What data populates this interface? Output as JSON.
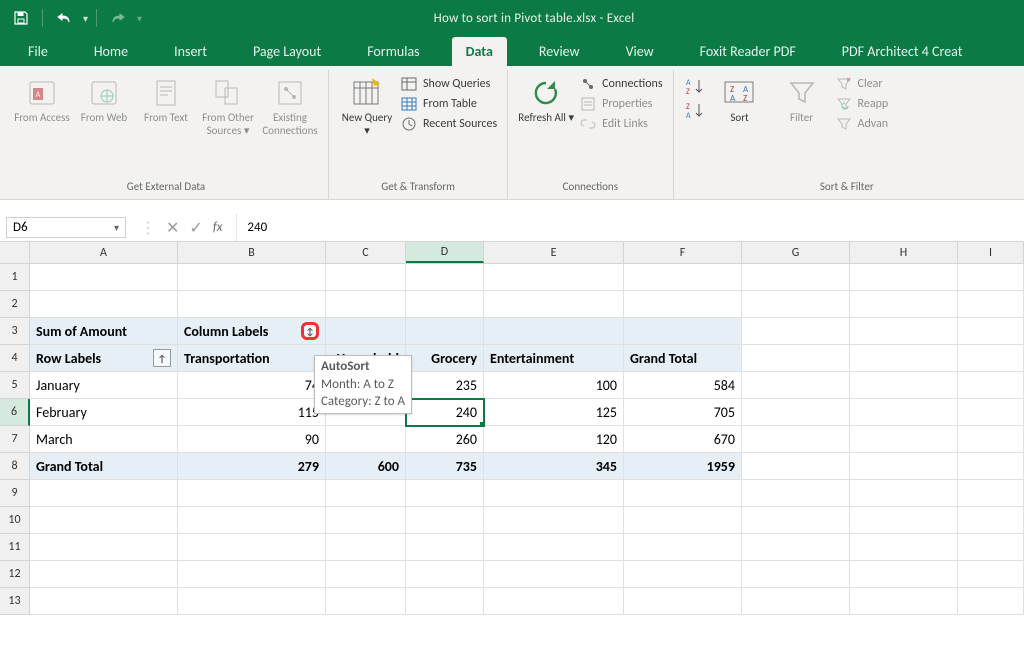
{
  "title": "How to sort in Pivot table.xlsx - Excel",
  "tabs": [
    "File",
    "Home",
    "Insert",
    "Page Layout",
    "Formulas",
    "Data",
    "Review",
    "View",
    "Foxit Reader PDF",
    "PDF Architect 4 Creat"
  ],
  "active_tab": "Data",
  "ribbon": {
    "get_external": {
      "access": "From Access",
      "web": "From Web",
      "text": "From Text",
      "other": "From Other Sources ▾",
      "existing": "Existing Connections",
      "label": "Get External Data"
    },
    "get_transform": {
      "new_query": "New Query ▾",
      "show": "Show Queries",
      "from_table": "From Table",
      "recent": "Recent Sources",
      "label": "Get & Transform"
    },
    "connections": {
      "refresh": "Refresh All ▾",
      "conn": "Connections",
      "props": "Properties",
      "links": "Edit Links",
      "label": "Connections"
    },
    "sort_filter": {
      "sort": "Sort",
      "filter": "Filter",
      "clear": "Clear",
      "reapply": "Reapp",
      "advanced": "Advan",
      "label": "Sort & Filter"
    }
  },
  "name_box": "D6",
  "formula_value": "240",
  "columns": [
    "A",
    "B",
    "C",
    "D",
    "E",
    "F",
    "G",
    "H",
    "I"
  ],
  "rows": [
    "1",
    "2",
    "3",
    "4",
    "5",
    "6",
    "7",
    "8",
    "9",
    "10",
    "11",
    "12",
    "13"
  ],
  "pivot": {
    "sum_label": "Sum of Amount",
    "col_labels": "Column Labels",
    "row_labels": "Row Labels",
    "cols": [
      "Transportation",
      "Household",
      "Grocery",
      "Entertainment",
      "Grand Total"
    ],
    "rows": [
      {
        "name": "January",
        "vals": [
          "74",
          "",
          "235",
          "100",
          "584"
        ]
      },
      {
        "name": "February",
        "vals": [
          "115",
          "",
          "240",
          "125",
          "705"
        ]
      },
      {
        "name": "March",
        "vals": [
          "90",
          "",
          "260",
          "120",
          "670"
        ]
      }
    ],
    "grand": {
      "name": "Grand Total",
      "vals": [
        "279",
        "600",
        "735",
        "345",
        "1959"
      ]
    }
  },
  "tooltip": {
    "title": "AutoSort",
    "l1": "Month: A to Z",
    "l2": "Category: Z to A"
  },
  "chart_data": {
    "type": "table",
    "title": "Sum of Amount",
    "columns": [
      "Transportation",
      "Household",
      "Grocery",
      "Entertainment",
      "Grand Total"
    ],
    "rows": [
      "January",
      "February",
      "March",
      "Grand Total"
    ],
    "values": [
      [
        74,
        null,
        235,
        100,
        584
      ],
      [
        115,
        null,
        240,
        125,
        705
      ],
      [
        90,
        null,
        260,
        120,
        670
      ],
      [
        279,
        600,
        735,
        345,
        1959
      ]
    ]
  }
}
